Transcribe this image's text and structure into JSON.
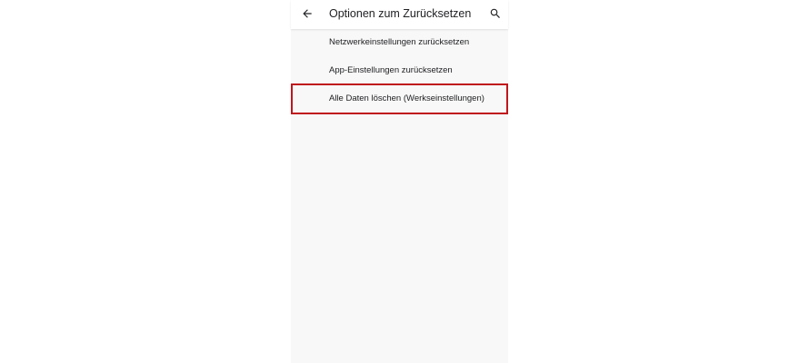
{
  "app_bar": {
    "title": "Optionen zum Zurücksetzen",
    "back_icon": "arrow-back-icon",
    "search_icon": "search-icon"
  },
  "reset_options": {
    "items": [
      {
        "label": "Netzwerkeinstellungen zurücksetzen"
      },
      {
        "label": "App-Einstellungen zurücksetzen"
      },
      {
        "label": "Alle Daten löschen (Werkseinstellungen)"
      }
    ]
  },
  "colors": {
    "highlight_border": "#c0161c",
    "screen_background": "#f8f8f8",
    "text": "#202124"
  }
}
